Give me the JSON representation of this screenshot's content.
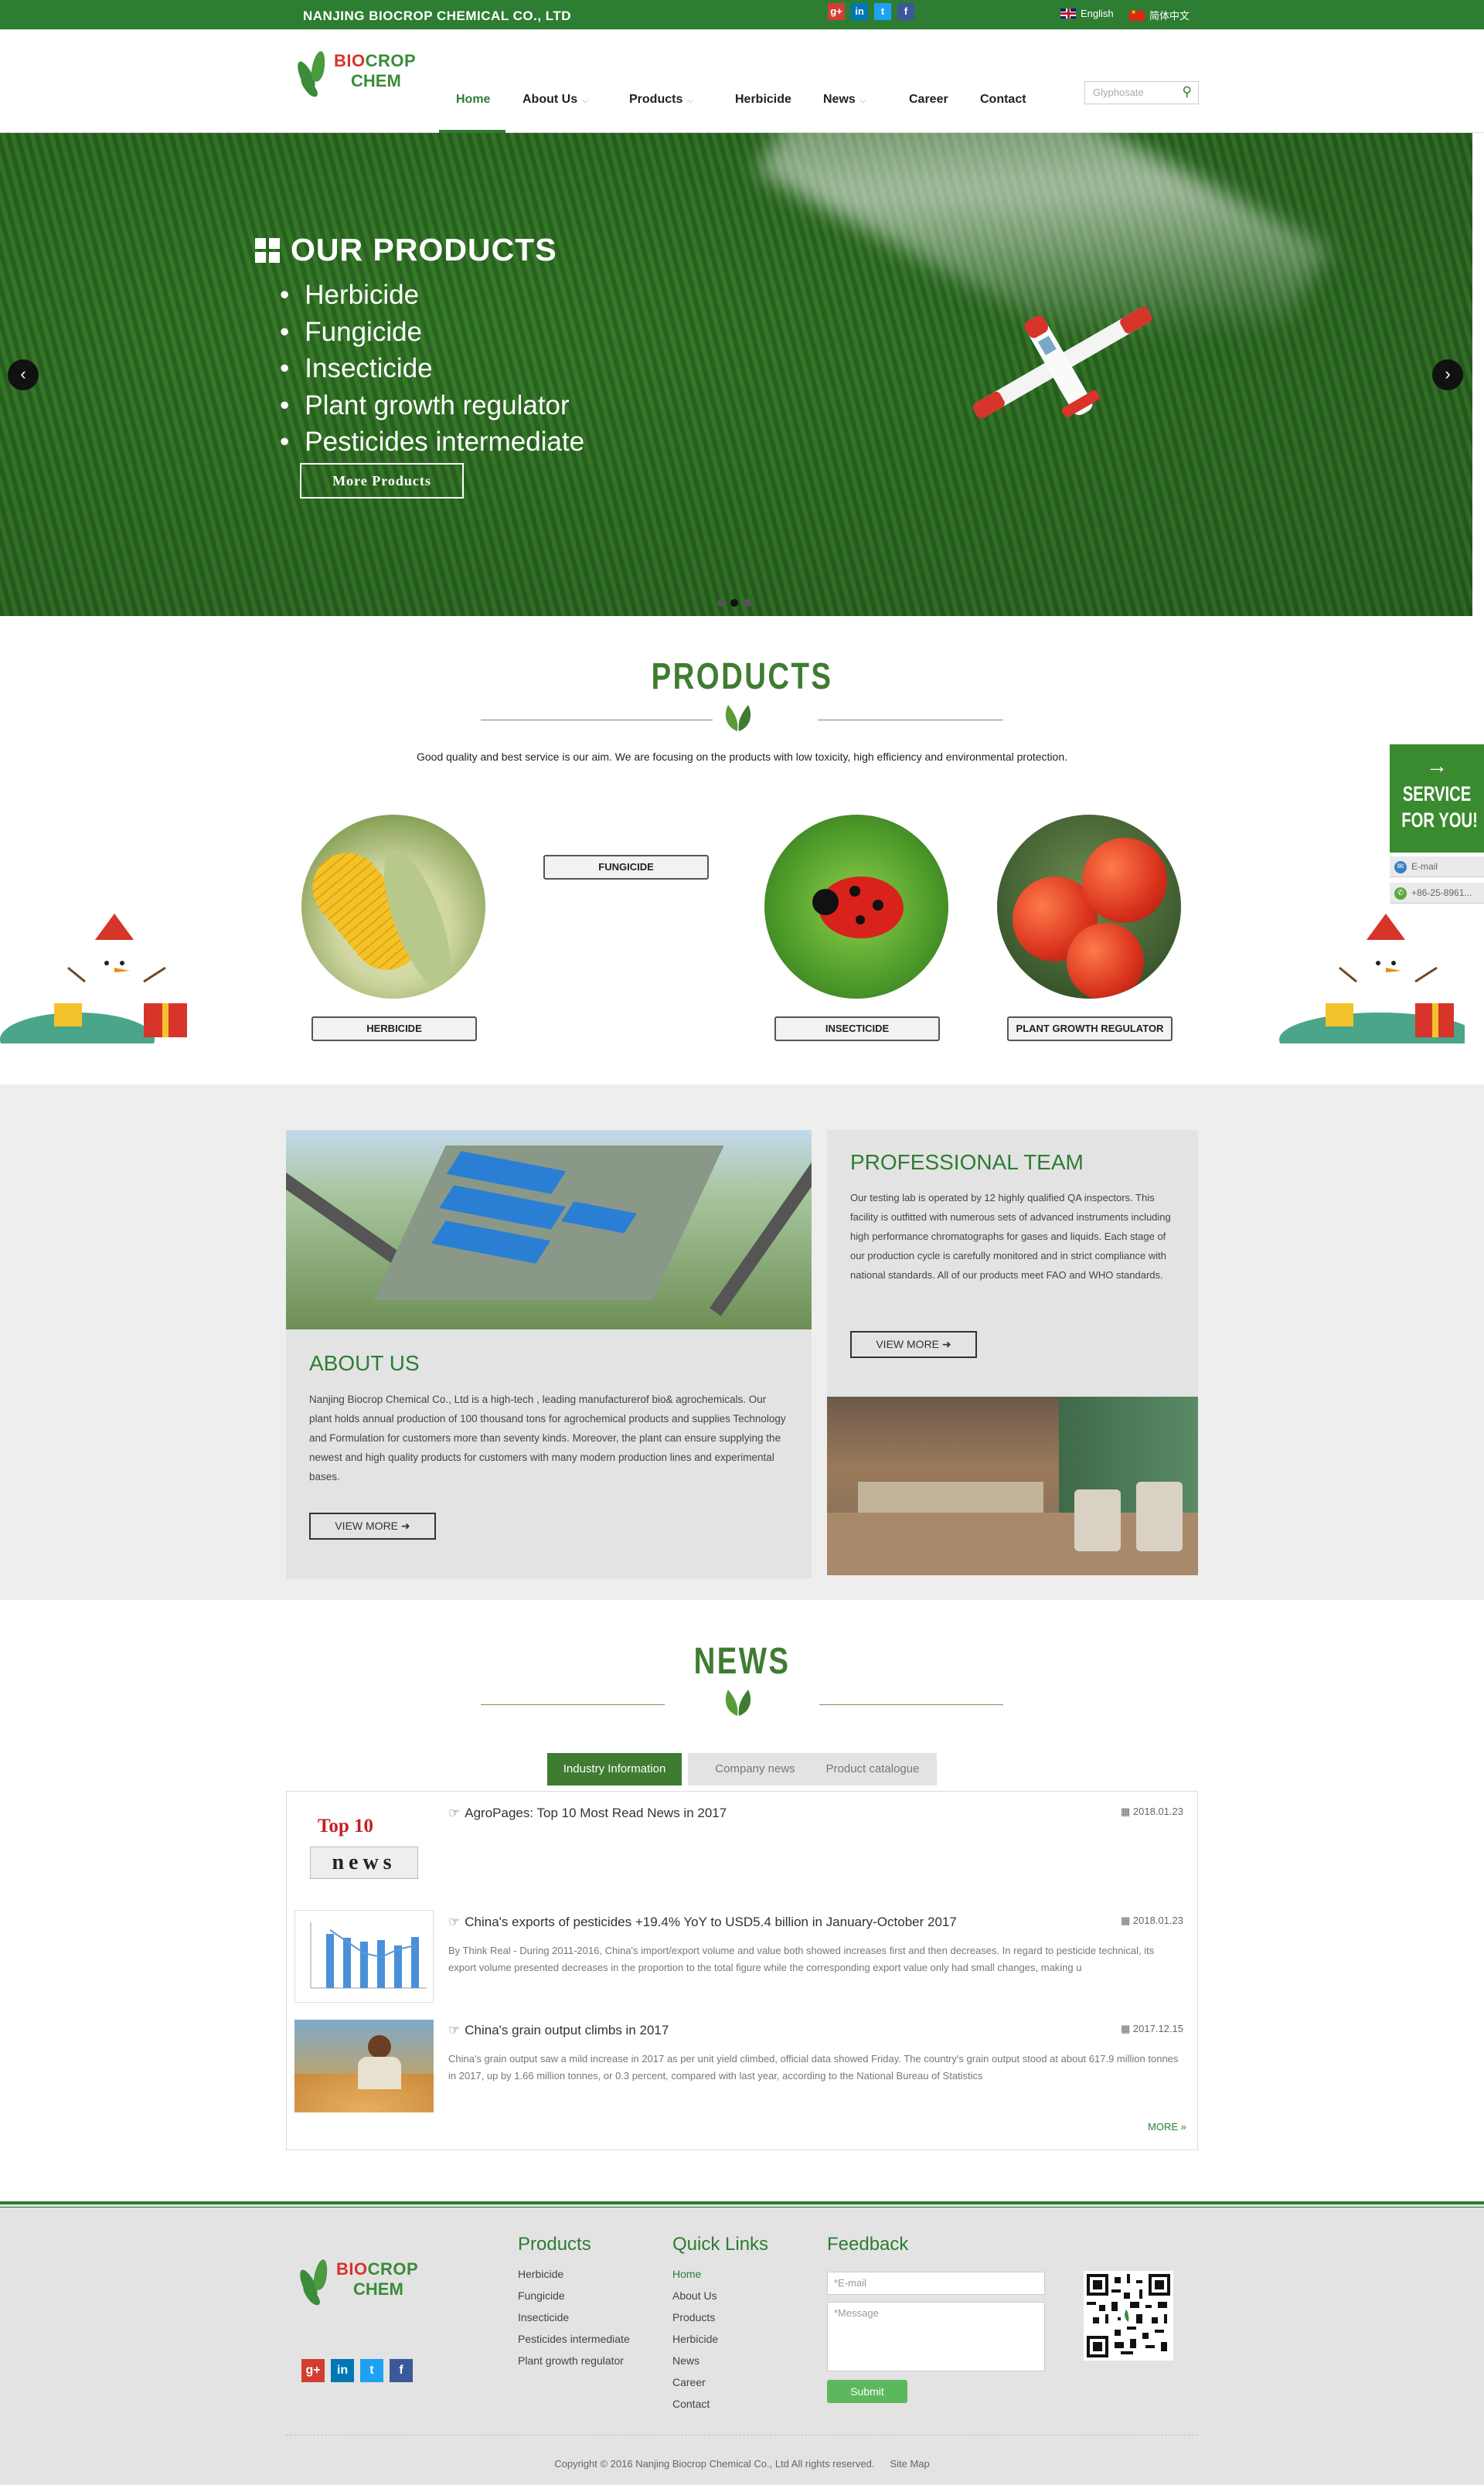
{
  "topbar": {
    "company": "NANJING BIOCROP CHEMICAL CO., LTD",
    "social": [
      "g+",
      "in",
      "t",
      "f"
    ],
    "lang_en": "English",
    "lang_cn": "简体中文"
  },
  "logo": {
    "line1_a": "BIO",
    "line1_b": "CROP",
    "line2": "CHEM"
  },
  "nav": {
    "items": [
      "Home",
      "About Us",
      "Products",
      "Herbicide",
      "News",
      "Career",
      "Contact"
    ],
    "search_placeholder": "Glyphosate"
  },
  "hero": {
    "title": "OUR PRODUCTS",
    "items": [
      "Herbicide",
      "Fungicide",
      "Insecticide",
      "Plant growth regulator",
      "Pesticides intermediate"
    ],
    "button": "More Products"
  },
  "products": {
    "title": "PRODUCTS",
    "intro": "Good quality and best service is our aim. We are focusing on the products with low toxicity, high efficiency and environmental protection.",
    "labels": [
      "HERBICIDE",
      "FUNGICIDE",
      "INSECTICIDE",
      "PLANT GROWTH REGULATOR"
    ]
  },
  "service": {
    "line1": "SERVICE",
    "line2": "FOR YOU!",
    "email": "E-mail",
    "phone": "+86-25-8961..."
  },
  "about": {
    "title": "ABOUT US",
    "text": "Nanjing Biocrop Chemical Co., Ltd is a high-tech , leading manufacturerof bio& agrochemicals. Our plant holds annual production of 100 thousand tons for agrochemical products and supplies Technology and Formulation for customers more than seventy kinds. Moreover, the plant can ensure supplying the newest and high quality products for customers with many modern production lines and experimental bases.",
    "button": "VIEW MORE"
  },
  "team": {
    "title": "PROFESSIONAL TEAM",
    "text": "Our testing lab is operated by 12 highly qualified QA inspectors. This facility is outfitted with numerous sets of advanced instruments including high performance chromatographs for gases and liquids. Each stage of our production cycle is carefully monitored and in strict compliance with national standards. All of our products meet FAO and WHO standards.",
    "button": "VIEW MORE"
  },
  "news": {
    "title": "NEWS",
    "tabs": [
      "Industry Information",
      "Company news",
      "Product catalogue"
    ],
    "items": [
      {
        "title": "AgroPages: Top 10 Most Read News in 2017",
        "date": "2018.01.23",
        "desc": "",
        "thumb_a": "Top 10",
        "thumb_b": "news"
      },
      {
        "title": "China's exports of pesticides +19.4% YoY to USD5.4 billion in January-October 2017",
        "date": "2018.01.23",
        "desc": "By Think Real - During 2011-2016, China's import/export volume and value both showed increases first and then decreases. In regard to pesticide technical, its export volume presented decreases in the proportion to the total figure while the corresponding export value only had small changes, making u"
      },
      {
        "title": "China's grain output climbs in 2017",
        "date": "2017.12.15",
        "desc": "China's grain output saw a mild increase in 2017 as per unit yield climbed, official data showed Friday. The country's grain output stood at about 617.9 million tonnes in 2017, up by 1.66 million tonnes, or 0.3 percent, compared with last year, according to the National Bureau of Statistics"
      }
    ],
    "more": "MORE »"
  },
  "footer": {
    "products_title": "Products",
    "products": [
      "Herbicide",
      "Fungicide",
      "Insecticide",
      "Pesticides intermediate",
      "Plant growth regulator"
    ],
    "quick_title": "Quick Links",
    "quick": [
      "Home",
      "About Us",
      "Products",
      "Herbicide",
      "News",
      "Career",
      "Contact"
    ],
    "feedback_title": "Feedback",
    "email_placeholder": "*E-mail",
    "message_placeholder": "*Message",
    "submit": "Submit",
    "copyright": "Copyright © 2016 Nanjing Biocrop Chemical Co., Ltd All rights reserved.",
    "sitemap": "Site Map"
  },
  "colors": {
    "brand_green": "#2d7d33",
    "accent_red": "#d7342a",
    "light_gray": "#eeeeee"
  }
}
